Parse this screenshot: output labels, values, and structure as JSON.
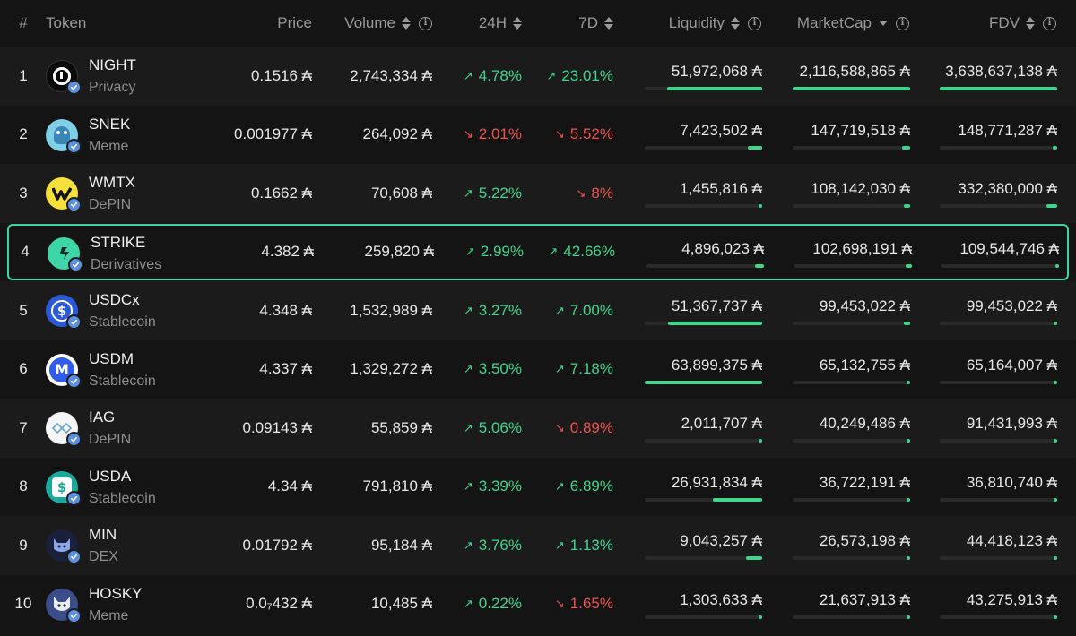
{
  "header": {
    "rank": "#",
    "token": "Token",
    "price": "Price",
    "volume": "Volume",
    "h24": "24H",
    "d7": "7D",
    "liquidity": "Liquidity",
    "marketcap": "MarketCap",
    "fdv": "FDV"
  },
  "colors": {
    "accent": "#3dd6a8",
    "up": "#3dd68c",
    "down": "#f0524d",
    "background": "#141414"
  },
  "rows": [
    {
      "rank": "1",
      "name": "NIGHT",
      "category": "Privacy",
      "icon": "night-logo-icon",
      "price": "0.1516 ₳",
      "volume": "2,743,334 ₳",
      "h24": "4.78%",
      "h24_dir": "up",
      "d7": "23.01%",
      "d7_dir": "up",
      "liquidity": "51,972,068 ₳",
      "liq_fill": 0.81,
      "marketcap": "2,116,588,865 ₳",
      "mc_fill": 1.0,
      "fdv": "3,638,637,138 ₳",
      "fdv_fill": 1.0
    },
    {
      "rank": "2",
      "name": "SNEK",
      "category": "Meme",
      "icon": "snek-logo-icon",
      "price": "0.001977 ₳",
      "volume": "264,092 ₳",
      "h24": "2.01%",
      "h24_dir": "down",
      "d7": "5.52%",
      "d7_dir": "down",
      "liquidity": "7,423,502 ₳",
      "liq_fill": 0.12,
      "marketcap": "147,719,518 ₳",
      "mc_fill": 0.07,
      "fdv": "148,771,287 ₳",
      "fdv_fill": 0.04
    },
    {
      "rank": "3",
      "name": "WMTX",
      "category": "DePIN",
      "icon": "wmtx-logo-icon",
      "price": "0.1662 ₳",
      "volume": "70,608 ₳",
      "h24": "5.22%",
      "h24_dir": "up",
      "d7": "8%",
      "d7_dir": "down",
      "liquidity": "1,455,816 ₳",
      "liq_fill": 0.02,
      "marketcap": "108,142,030 ₳",
      "mc_fill": 0.05,
      "fdv": "332,380,000 ₳",
      "fdv_fill": 0.09
    },
    {
      "rank": "4",
      "name": "STRIKE",
      "category": "Derivatives",
      "icon": "strike-logo-icon",
      "price": "4.382 ₳",
      "volume": "259,820 ₳",
      "h24": "2.99%",
      "h24_dir": "up",
      "d7": "42.66%",
      "d7_dir": "up",
      "liquidity": "4,896,023 ₳",
      "liq_fill": 0.08,
      "marketcap": "102,698,191 ₳",
      "mc_fill": 0.05,
      "fdv": "109,544,746 ₳",
      "fdv_fill": 0.03
    },
    {
      "rank": "5",
      "name": "USDCx",
      "category": "Stablecoin",
      "icon": "usdcx-logo-icon",
      "price": "4.348 ₳",
      "volume": "1,532,989 ₳",
      "h24": "3.27%",
      "h24_dir": "up",
      "d7": "7.00%",
      "d7_dir": "up",
      "liquidity": "51,367,737 ₳",
      "liq_fill": 0.8,
      "marketcap": "99,453,022 ₳",
      "mc_fill": 0.05,
      "fdv": "99,453,022 ₳",
      "fdv_fill": 0.03
    },
    {
      "rank": "6",
      "name": "USDM",
      "category": "Stablecoin",
      "icon": "usdm-logo-icon",
      "price": "4.337 ₳",
      "volume": "1,329,272 ₳",
      "h24": "3.50%",
      "h24_dir": "up",
      "d7": "7.18%",
      "d7_dir": "up",
      "liquidity": "63,899,375 ₳",
      "liq_fill": 1.0,
      "marketcap": "65,132,755 ₳",
      "mc_fill": 0.03,
      "fdv": "65,164,007 ₳",
      "fdv_fill": 0.02
    },
    {
      "rank": "7",
      "name": "IAG",
      "category": "DePIN",
      "icon": "iag-logo-icon",
      "price": "0.09143 ₳",
      "volume": "55,859 ₳",
      "h24": "5.06%",
      "h24_dir": "up",
      "d7": "0.89%",
      "d7_dir": "down",
      "liquidity": "2,011,707 ₳",
      "liq_fill": 0.03,
      "marketcap": "40,249,486 ₳",
      "mc_fill": 0.02,
      "fdv": "91,431,993 ₳",
      "fdv_fill": 0.03
    },
    {
      "rank": "8",
      "name": "USDA",
      "category": "Stablecoin",
      "icon": "usda-logo-icon",
      "price": "4.34 ₳",
      "volume": "791,810 ₳",
      "h24": "3.39%",
      "h24_dir": "up",
      "d7": "6.89%",
      "d7_dir": "up",
      "liquidity": "26,931,834 ₳",
      "liq_fill": 0.42,
      "marketcap": "36,722,191 ₳",
      "mc_fill": 0.02,
      "fdv": "36,810,740 ₳",
      "fdv_fill": 0.01
    },
    {
      "rank": "9",
      "name": "MIN",
      "category": "DEX",
      "icon": "min-logo-icon",
      "price": "0.01792 ₳",
      "volume": "95,184 ₳",
      "h24": "3.76%",
      "h24_dir": "up",
      "d7": "1.13%",
      "d7_dir": "up",
      "liquidity": "9,043,257 ₳",
      "liq_fill": 0.14,
      "marketcap": "26,573,198 ₳",
      "mc_fill": 0.01,
      "fdv": "44,418,123 ₳",
      "fdv_fill": 0.01
    },
    {
      "rank": "10",
      "name": "HOSKY",
      "category": "Meme",
      "icon": "hosky-logo-icon",
      "price": "0.0₇432 ₳",
      "volume": "10,485 ₳",
      "h24": "0.22%",
      "h24_dir": "up",
      "d7": "1.65%",
      "d7_dir": "down",
      "liquidity": "1,303,633 ₳",
      "liq_fill": 0.02,
      "marketcap": "21,637,913 ₳",
      "mc_fill": 0.01,
      "fdv": "43,275,913 ₳",
      "fdv_fill": 0.01
    }
  ]
}
